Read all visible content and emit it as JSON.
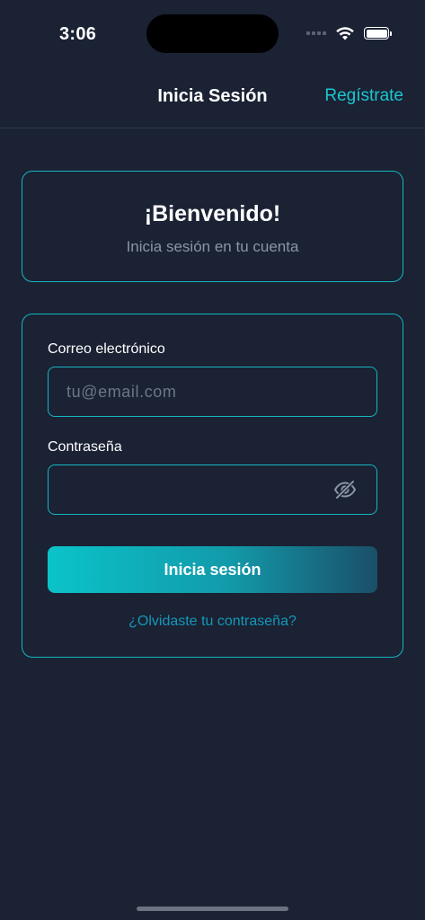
{
  "status_bar": {
    "time": "3:06"
  },
  "nav": {
    "title": "Inicia Sesión",
    "action_label": "Regístrate"
  },
  "welcome": {
    "title": "¡Bienvenido!",
    "subtitle": "Inicia sesión en tu cuenta"
  },
  "form": {
    "email_label": "Correo electrónico",
    "email_value": "",
    "email_placeholder": "tu@email.com",
    "password_label": "Contraseña",
    "password_value": "",
    "password_placeholder": "",
    "toggle_icon": "eye-slash-icon",
    "submit_label": "Inicia sesión",
    "forgot_label": "¿Olvidaste tu contraseña?"
  },
  "colors": {
    "background": "#1a2234",
    "accent": "#16b6c1",
    "link": "#1597b7",
    "muted_text": "#8b95a6"
  }
}
